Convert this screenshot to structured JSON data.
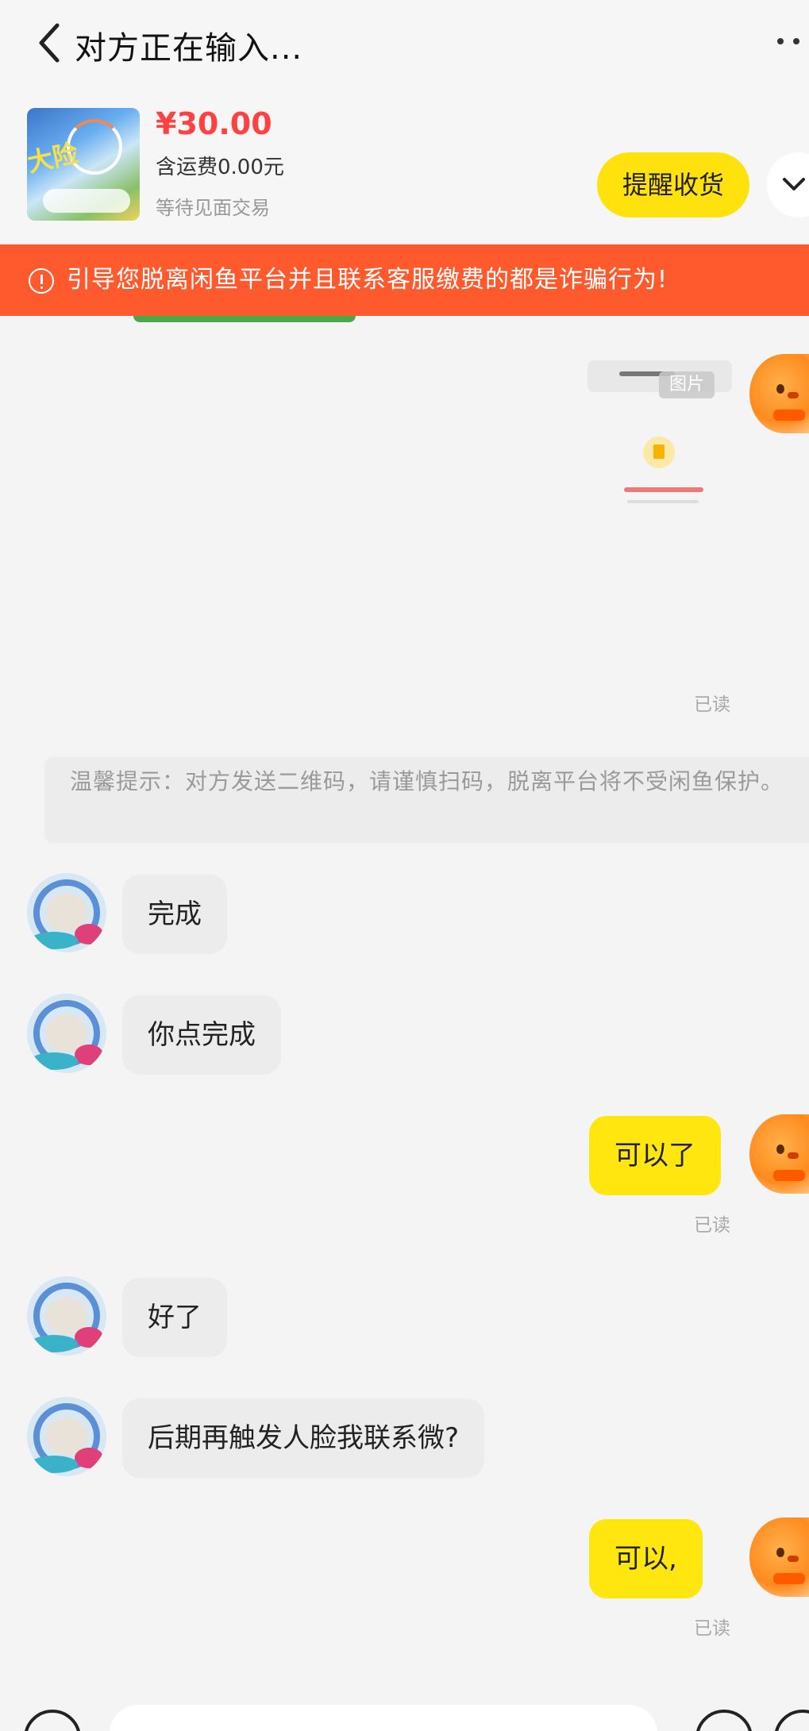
{
  "header": {
    "title": "对方正在输入..."
  },
  "product": {
    "price": "¥30.00",
    "shipping": "含运费0.00元",
    "status": "等待见面交易",
    "remind_button": "提醒收货"
  },
  "warning": {
    "text": "引导您脱离闲鱼平台并且联系客服缴费的都是诈骗行为!"
  },
  "messages": [
    {
      "from": "me",
      "type": "image",
      "label": "图片",
      "read": "已读"
    },
    {
      "from": "system",
      "text": "温馨提示：对方发送二维码，请谨慎扫码，脱离平台将不受闲鱼保护。"
    },
    {
      "from": "other",
      "text": "完成"
    },
    {
      "from": "other",
      "text": "你点完成"
    },
    {
      "from": "me",
      "text": "可以了",
      "read": "已读"
    },
    {
      "from": "other",
      "text": "好了"
    },
    {
      "from": "other",
      "text": "后期再触发人脸我联系微?"
    },
    {
      "from": "me",
      "text": "可以,",
      "read": "已读"
    }
  ],
  "colors": {
    "warning_bg": "#ff5a2d",
    "accent_yellow": "#ffe20d",
    "price_red": "#ff4141"
  }
}
